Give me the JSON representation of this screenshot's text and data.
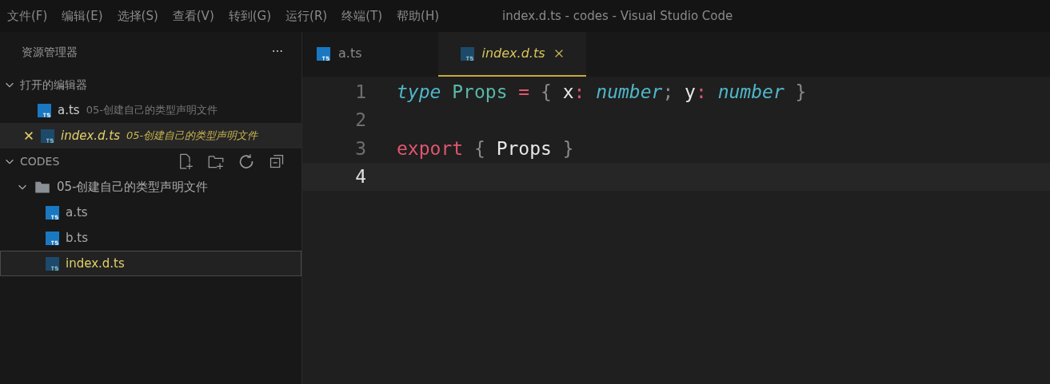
{
  "menu": [
    "文件(F)",
    "编辑(E)",
    "选择(S)",
    "查看(V)",
    "转到(G)",
    "运行(R)",
    "终端(T)",
    "帮助(H)"
  ],
  "window": {
    "title": "index.d.ts - codes - Visual Studio Code"
  },
  "sidebar": {
    "title": "资源管理器",
    "more": "···",
    "open_editors": {
      "label": "打开的编辑器",
      "expanded": true,
      "items": [
        {
          "name": "a.ts",
          "path": "05-创建自己的类型声明文件",
          "selected": false
        },
        {
          "name": "index.d.ts",
          "path": "05-创建自己的类型声明文件",
          "selected": true
        }
      ]
    },
    "workspace": {
      "label": "CODES",
      "expanded": true,
      "tree": [
        {
          "name": "05-创建自己的类型声明文件",
          "kind": "folder",
          "expanded": true,
          "selected": false,
          "children": [
            {
              "name": "a.ts",
              "kind": "file",
              "selected": false
            },
            {
              "name": "b.ts",
              "kind": "file",
              "selected": false
            },
            {
              "name": "index.d.ts",
              "kind": "file",
              "selected": true
            }
          ]
        }
      ]
    }
  },
  "tabs": [
    {
      "label": "a.ts",
      "selected": false
    },
    {
      "label": "index.d.ts",
      "selected": true
    }
  ],
  "code": [
    {
      "number": "1",
      "current": false,
      "tokens": [
        {
          "text": "type",
          "kind": "keyword"
        },
        {
          "text": " Props",
          "kind": "type"
        },
        {
          "text": " =",
          "kind": "operator"
        },
        {
          "text": " {",
          "kind": "punct"
        },
        {
          "text": " x",
          "kind": "ident"
        },
        {
          "text": ":",
          "kind": "operator"
        },
        {
          "text": " number",
          "kind": "keyword"
        },
        {
          "text": ";",
          "kind": "punct"
        },
        {
          "text": " y",
          "kind": "ident"
        },
        {
          "text": ":",
          "kind": "operator"
        },
        {
          "text": " number",
          "kind": "keyword"
        },
        {
          "text": " }",
          "kind": "punct"
        }
      ]
    },
    {
      "number": "2",
      "current": false
    },
    {
      "number": "3",
      "current": false,
      "tokens": [
        {
          "text": "export",
          "kind": "export"
        },
        {
          "text": " {",
          "kind": "punct"
        },
        {
          "text": " Props",
          "kind": "ident"
        },
        {
          "text": " }",
          "kind": "punct"
        }
      ]
    },
    {
      "number": "4",
      "current": true
    }
  ]
}
